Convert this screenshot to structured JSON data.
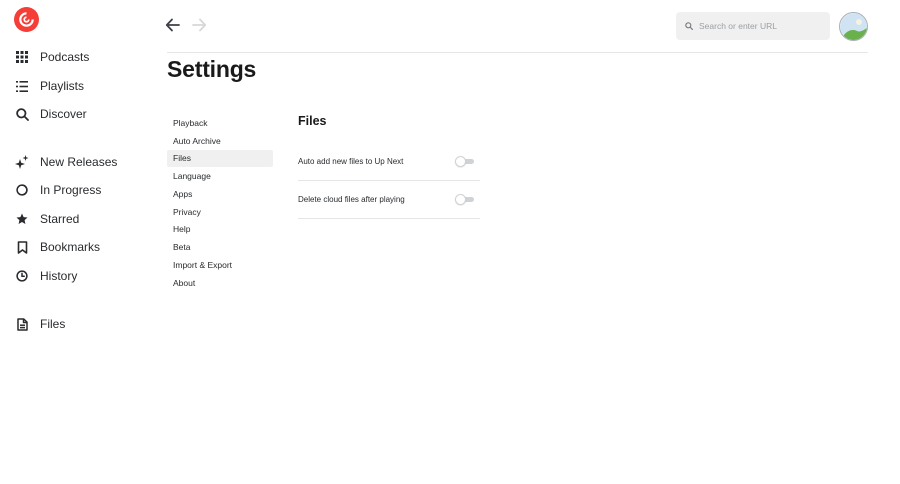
{
  "colors": {
    "brand": "#f43e37",
    "text": "#292b2e",
    "muted": "#9a9ea3",
    "active_bg": "#f0f0f0",
    "divider": "#e6e6e6"
  },
  "sidebar": {
    "logo_icon": "pocket-casts-logo",
    "items": [
      {
        "label": "Podcasts",
        "icon": "grid-icon"
      },
      {
        "label": "Playlists",
        "icon": "list-icon"
      },
      {
        "label": "Discover",
        "icon": "search-icon"
      },
      {
        "label": "New Releases",
        "icon": "sparkle-icon"
      },
      {
        "label": "In Progress",
        "icon": "progress-circle-icon"
      },
      {
        "label": "Starred",
        "icon": "star-icon"
      },
      {
        "label": "Bookmarks",
        "icon": "bookmark-icon"
      },
      {
        "label": "History",
        "icon": "clock-icon"
      },
      {
        "label": "Files",
        "icon": "file-icon"
      }
    ]
  },
  "header": {
    "back_icon": "arrow-left-icon",
    "forward_icon": "arrow-right-icon",
    "search_placeholder": "Search or enter URL",
    "search_icon": "search-icon",
    "avatar_icon": "avatar"
  },
  "page": {
    "title": "Settings"
  },
  "settings_nav": {
    "active": "Files",
    "items": [
      "Playback",
      "Auto Archive",
      "Files",
      "Language",
      "Apps",
      "Privacy",
      "Help",
      "Beta",
      "Import & Export",
      "About"
    ]
  },
  "panel": {
    "title": "Files",
    "rows": [
      {
        "label": "Auto add new files to Up Next",
        "enabled": false
      },
      {
        "label": "Delete cloud files after playing",
        "enabled": false
      }
    ]
  }
}
